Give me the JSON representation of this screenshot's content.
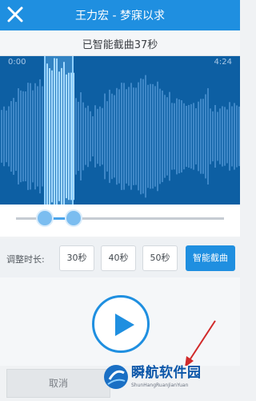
{
  "header": {
    "title": "王力宏 - 梦寐以求",
    "close_icon": "close-icon"
  },
  "status": {
    "text": "已智能截曲37秒"
  },
  "waveform": {
    "time_start": "0:00",
    "time_end": "4:24",
    "colors": {
      "background": "#0d5fa3",
      "wave": "#3a84c5",
      "selection": "#8fd0ff"
    }
  },
  "duration": {
    "label": "调整时长:",
    "options": [
      "30秒",
      "40秒",
      "50秒",
      "智能截曲"
    ],
    "selected": "智能截曲"
  },
  "player": {
    "play_icon": "play-icon"
  },
  "footer": {
    "cancel_label": "取消"
  },
  "watermark": {
    "title": "瞬航软件园",
    "subtitle": "ShunHangRuanJianYuan"
  },
  "colors": {
    "accent": "#1f8fe0",
    "wave_bg": "#0d5fa3"
  }
}
